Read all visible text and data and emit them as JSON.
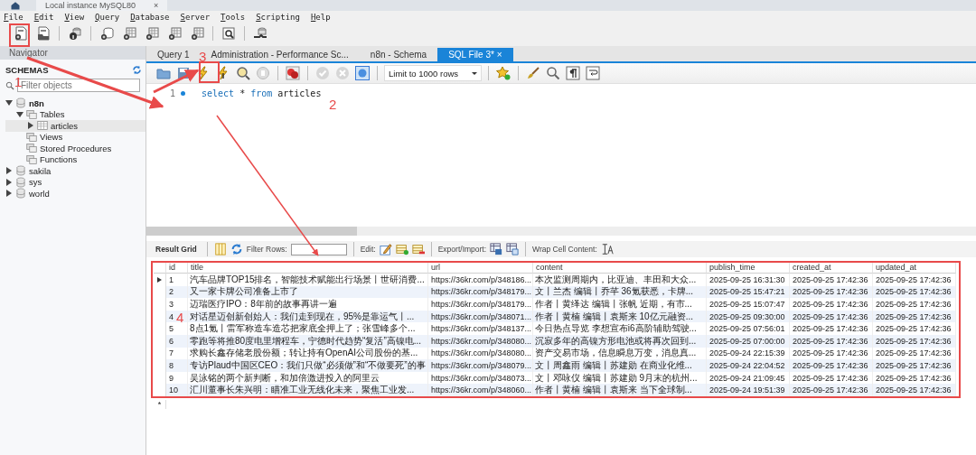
{
  "app_tab": {
    "title": "Local instance MySQL80",
    "close": "×"
  },
  "menu": [
    "File",
    "Edit",
    "View",
    "Query",
    "Database",
    "Server",
    "Tools",
    "Scripting",
    "Help"
  ],
  "navigator": {
    "title": "Navigator",
    "section": "SCHEMAS",
    "filter_placeholder": "Filter objects",
    "tree": [
      {
        "label": "n8n",
        "kind": "schema",
        "default": true,
        "expanded": true,
        "selected": false,
        "children": [
          {
            "label": "Tables",
            "kind": "folder",
            "expanded": true,
            "selected": false,
            "children": [
              {
                "label": "articles",
                "kind": "table",
                "expanded": false,
                "selected": true
              }
            ]
          },
          {
            "label": "Views",
            "kind": "folder",
            "selected": false
          },
          {
            "label": "Stored Procedures",
            "kind": "folder",
            "selected": false
          },
          {
            "label": "Functions",
            "kind": "folder",
            "selected": false
          }
        ]
      },
      {
        "label": "sakila",
        "kind": "schema",
        "default": false,
        "expanded": false,
        "selected": false
      },
      {
        "label": "sys",
        "kind": "schema",
        "default": false,
        "expanded": false,
        "selected": false
      },
      {
        "label": "world",
        "kind": "schema",
        "default": false,
        "expanded": false,
        "selected": false
      }
    ]
  },
  "query_tabs": [
    {
      "label": "Query 1",
      "selected": false
    },
    {
      "label": "Administration - Performance Sc...",
      "selected": false
    },
    {
      "label": "n8n - Schema",
      "selected": false
    },
    {
      "label": "SQL File 3*",
      "selected": true,
      "close": "×"
    }
  ],
  "limit_dropdown": "Limit to 1000 rows",
  "editor": {
    "lines": [
      {
        "number": "1",
        "tokens": [
          {
            "text": "select",
            "kind": "keyword"
          },
          {
            "text": "*",
            "kind": "plain"
          },
          {
            "text": "from",
            "kind": "keyword"
          },
          {
            "text": "articles",
            "kind": "plain"
          }
        ]
      }
    ]
  },
  "result_toolbar": {
    "tab": "Result Grid",
    "filter_label": "Filter Rows:",
    "edit_label": "Edit:",
    "export_label": "Export/Import:",
    "wrap_label": "Wrap Cell Content:"
  },
  "grid": {
    "columns": [
      "id",
      "title",
      "url",
      "content",
      "publish_time",
      "created_at",
      "updated_at"
    ],
    "rows": [
      {
        "current": true,
        "cells": [
          "1",
          "汽车品牌TOP15排名，智能技术赋能出行场景丨世研消费...",
          "https://36kr.com/p/348186...",
          "本次监测周期内，比亚迪、丰田和大众...",
          "2025-09-25 16:31:30",
          "2025-09-25 17:42:36",
          "2025-09-25 17:42:36"
        ]
      },
      {
        "current": false,
        "cells": [
          "2",
          "又一家卡牌公司准备上市了",
          "https://36kr.com/p/348179...",
          "文丨兰杰 编辑丨乔芊 36氪获悉，卡牌...",
          "2025-09-25 15:47:21",
          "2025-09-25 17:42:36",
          "2025-09-25 17:42:36"
        ]
      },
      {
        "current": false,
        "cells": [
          "3",
          "迈瑞医疗IPO：8年前的故事再讲一遍",
          "https://36kr.com/p/348179...",
          "作者丨黄绎达 编辑丨张帆 近期，有市...",
          "2025-09-25 15:07:47",
          "2025-09-25 17:42:36",
          "2025-09-25 17:42:36"
        ]
      },
      {
        "current": false,
        "cells": [
          "4",
          "对话星迈创新创始人：我们走到现在，95%是靠运气丨...",
          "https://36kr.com/p/348071...",
          "作者丨黄楠 编辑丨袁斯来 10亿元融资...",
          "2025-09-25 09:30:00",
          "2025-09-25 17:42:36",
          "2025-09-25 17:42:36"
        ]
      },
      {
        "current": false,
        "cells": [
          "5",
          "8点1氪丨雷军称造车造芯把家底全押上了；张雪峰多个...",
          "https://36kr.com/p/348137...",
          "今日热点导览 李想宣布i6高阶辅助驾驶...",
          "2025-09-25 07:56:01",
          "2025-09-25 17:42:36",
          "2025-09-25 17:42:36"
        ]
      },
      {
        "current": false,
        "cells": [
          "6",
          "零跑等将推80度电里增程车，宁德时代趋势“复活”高镍电...",
          "https://36kr.com/p/348080...",
          "沉寂多年的高镍方形电池或将再次回到...",
          "2025-09-25 07:00:00",
          "2025-09-25 17:42:36",
          "2025-09-25 17:42:36"
        ]
      },
      {
        "current": false,
        "cells": [
          "7",
          "求购长鑫存储老股份额；转让持有OpenAI公司股份的基...",
          "https://36kr.com/p/348080...",
          "资产交易市场，信息瞬息万变，消息真...",
          "2025-09-24 22:15:39",
          "2025-09-25 17:42:36",
          "2025-09-25 17:42:36"
        ]
      },
      {
        "current": false,
        "cells": [
          "8",
          "专访Plaud中国区CEO：我们只做“必须做”和“不做要死”的事",
          "https://36kr.com/p/348079...",
          "文丨周鑫雨 编辑丨苏建勋 在商业化维...",
          "2025-09-24 22:04:52",
          "2025-09-25 17:42:36",
          "2025-09-25 17:42:36"
        ]
      },
      {
        "current": false,
        "cells": [
          "9",
          "吴泳铭的两个新判断，和加倍激进投入的阿里云",
          "https://36kr.com/p/348073...",
          "文丨邓咏仪 编辑丨苏建勋 9月末的杭州...",
          "2025-09-24 21:09:45",
          "2025-09-25 17:42:36",
          "2025-09-25 17:42:36"
        ]
      },
      {
        "current": false,
        "cells": [
          "10",
          "汇川董事长朱兴明：瞄准工业无线化未来，聚焦工业发...",
          "https://36kr.com/p/348060...",
          "作者丨黄楠 编辑丨袁斯来 当下全球制...",
          "2025-09-24 19:51:39",
          "2025-09-25 17:42:36",
          "2025-09-25 17:42:36"
        ]
      }
    ],
    "new_row_marker": "*"
  },
  "annotations": [
    {
      "label": "1"
    },
    {
      "label": "2"
    },
    {
      "label": "3"
    },
    {
      "label": "4"
    }
  ]
}
